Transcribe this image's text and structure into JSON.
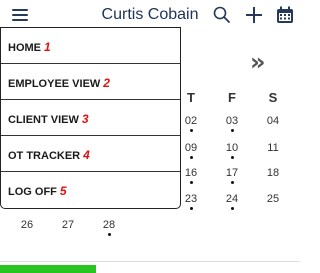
{
  "header": {
    "title": "Curtis Cobain",
    "menu_icon": "hamburger-icon",
    "search_icon": "search-icon",
    "add_icon": "plus-icon",
    "calendar_icon": "calendar-icon"
  },
  "calendar": {
    "next_label": "»",
    "weekdays": [
      "T",
      "F",
      "S"
    ],
    "days": [
      {
        "label": "02"
      },
      {
        "label": "03"
      },
      {
        "label": "04"
      },
      {
        "label": "09"
      },
      {
        "label": "10"
      },
      {
        "label": "11"
      },
      {
        "label": "16"
      },
      {
        "label": "17"
      },
      {
        "label": "18"
      },
      {
        "label": "23"
      },
      {
        "label": "24"
      },
      {
        "label": "25"
      },
      {
        "label": "26"
      },
      {
        "label": "27"
      },
      {
        "label": "28"
      }
    ]
  },
  "menu": {
    "items": [
      {
        "label": "HOME",
        "num": "1"
      },
      {
        "label": "EMPLOYEE VIEW",
        "num": "2"
      },
      {
        "label": "CLIENT VIEW",
        "num": "3"
      },
      {
        "label": "OT TRACKER",
        "num": "4"
      },
      {
        "label": "LOG OFF",
        "num": "5"
      }
    ]
  },
  "progress": {
    "fraction": 0.32,
    "color": "#28c41f"
  }
}
